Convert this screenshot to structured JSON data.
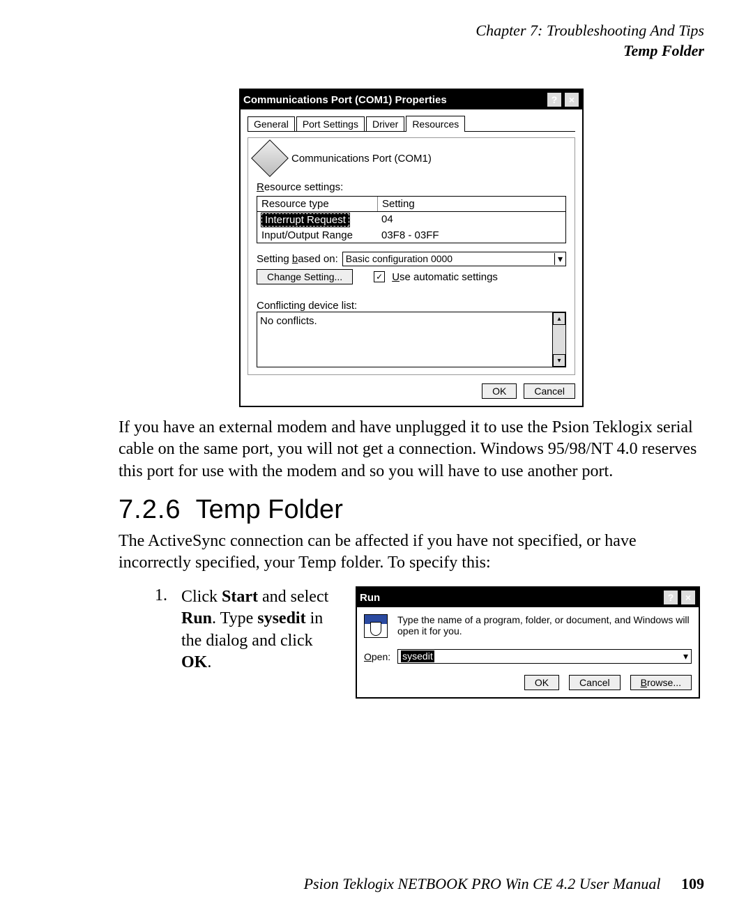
{
  "header": {
    "chapter_line": "Chapter 7:  Troubleshooting And Tips",
    "section_line": "Temp Folder"
  },
  "com1_dialog": {
    "title": "Communications Port (COM1) Properties",
    "help_btn": "?",
    "close_btn": "×",
    "tabs": {
      "general": "General",
      "port_settings": "Port Settings",
      "driver": "Driver",
      "resources": "Resources"
    },
    "device_name": "Communications Port (COM1)",
    "resource_settings_label": "Resource settings:",
    "table": {
      "head_type": "Resource type",
      "head_setting": "Setting",
      "row1_type": "Interrupt Request",
      "row1_setting": "04",
      "row2_type": "Input/Output Range",
      "row2_setting": "03F8 - 03FF"
    },
    "setting_based_label": "Setting based on:",
    "setting_based_value": "Basic configuration 0000",
    "change_setting_btn": "Change Setting...",
    "use_auto_label": "Use automatic settings",
    "conflict_label": "Conflicting device list:",
    "conflict_text": "No conflicts.",
    "ok_btn": "OK",
    "cancel_btn": "Cancel"
  },
  "body_para": "If you have an external modem and have unplugged it to use the Psion Teklogix serial cable on the same port, you will not get a connection. Windows 95/98/NT 4.0 reserves this port for use with the modem and so you will have to use another port.",
  "heading": {
    "number": "7.2.6",
    "title": "Temp Folder"
  },
  "intro_para": "The ActiveSync connection can be affected if you have not specified, or have incorrectly specified, your Temp folder. To specify this:",
  "step": {
    "number": "1.",
    "line1a": "Click ",
    "start": "Start",
    "line1b": " and select ",
    "run": "Run",
    "line1c": ". Type ",
    "sysedit": "sysedit",
    "line1d": " in the dialog and click ",
    "ok": "OK",
    "line1e": "."
  },
  "run_dialog": {
    "title": "Run",
    "help_btn": "?",
    "close_btn": "×",
    "message": "Type the name of a program, folder, or document, and Windows will open it for you.",
    "open_label": "Open:",
    "open_value": "sysedit",
    "ok_btn": "OK",
    "cancel_btn": "Cancel",
    "browse_btn": "Browse..."
  },
  "footer": {
    "manual": "Psion Teklogix NETBOOK PRO Win CE 4.2 User Manual",
    "page_number": "109"
  }
}
